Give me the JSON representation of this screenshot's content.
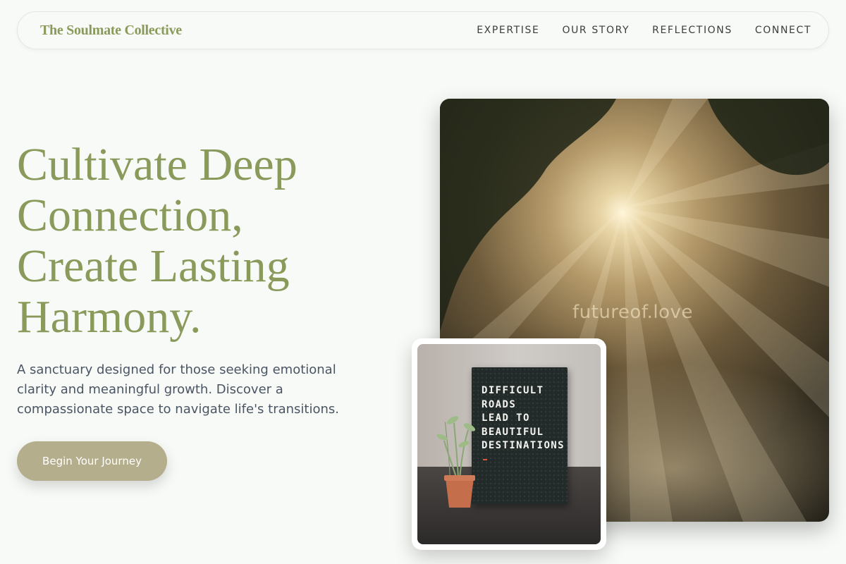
{
  "header": {
    "brand": "The Soulmate Collective",
    "nav": [
      "EXPERTISE",
      "OUR STORY",
      "REFLECTIONS",
      "CONNECT"
    ]
  },
  "hero": {
    "headline_lines": [
      "Cultivate Deep",
      "Connection,",
      "Create Lasting",
      "Harmony."
    ],
    "subtext_lines": [
      "A sanctuary designed for those seeking emotional",
      "clarity and meaningful growth. Discover a",
      "compassionate space to navigate life's transitions."
    ],
    "cta_label": "Begin Your Journey"
  },
  "main_image": {
    "watermark": "futureof.love"
  },
  "secondary_image": {
    "board_lines": [
      "DIFFICULT",
      "ROADS",
      "LEAD TO",
      "BEAUTIFUL",
      "DESTINATIONS"
    ]
  },
  "colors": {
    "accent": "#8a9a5b",
    "button": "#b5ae8c",
    "background": "#f8faf7",
    "body_text": "#4a5563"
  }
}
